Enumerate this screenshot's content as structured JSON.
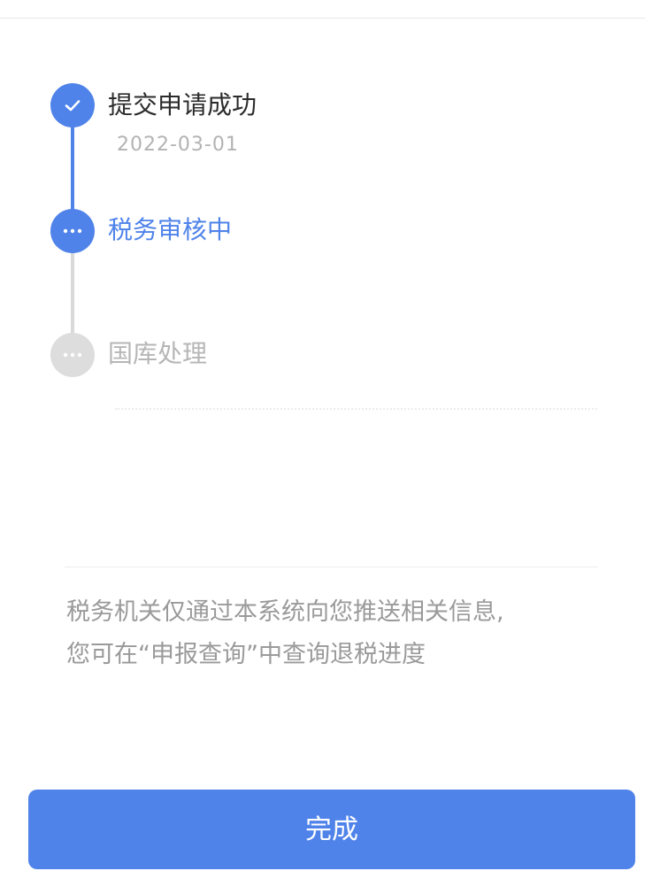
{
  "timeline": {
    "steps": [
      {
        "label": "提交申请成功",
        "date": "2022-03-01",
        "status": "completed",
        "icon": "check-icon"
      },
      {
        "label": "税务审核中",
        "status": "in-progress",
        "icon": "ellipsis-icon"
      },
      {
        "label": "国库处理",
        "status": "pending",
        "icon": "ellipsis-icon"
      }
    ]
  },
  "notice": {
    "line1": "税务机关仅通过本系统向您推送相关信息,",
    "line2": "您可在“申报查询”中查询退税进度"
  },
  "actions": {
    "finish_label": "完成"
  },
  "colors": {
    "accent": "#4f83ea",
    "pending": "#dddddd",
    "text_primary": "#2b2b2b",
    "text_muted": "#9a9a9a"
  }
}
